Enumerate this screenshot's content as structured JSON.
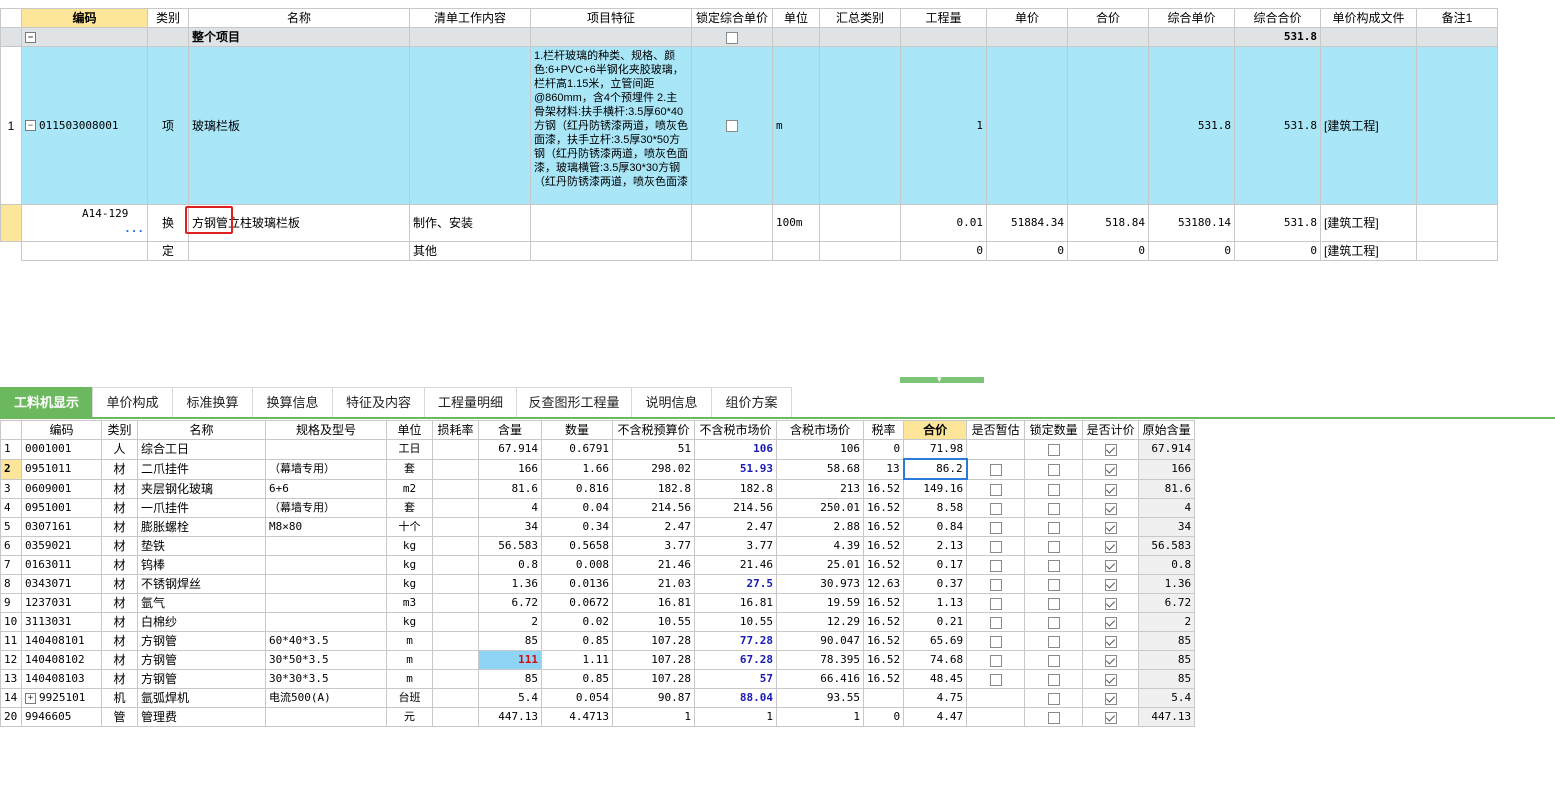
{
  "top_table": {
    "headers": [
      "编码",
      "类别",
      "名称",
      "清单工作内容",
      "项目特征",
      "锁定综合单价",
      "单位",
      "汇总类别",
      "工程量",
      "单价",
      "合价",
      "综合单价",
      "综合合价",
      "单价构成文件",
      "备注1"
    ],
    "group_row": {
      "name": "整个项目",
      "total": "531.8"
    },
    "main_row": {
      "num": "1",
      "code": "011503008001",
      "type": "项",
      "name": "玻璃栏板",
      "features": "1.栏杆玻璃的种类、规格、颜色:6+PVC+6半钢化夹胶玻璃，栏杆高1.15米，立管间距@860mm，含4个预埋件\n2.主骨架材料:扶手横杆:3.5厚60*40方钢（红丹防锈漆两道，喷灰色面漆，扶手立杆:3.5厚30*50方钢（红丹防锈漆两道，喷灰色面漆，玻璃横管:3.5厚30*30方钢（红丹防锈漆两道，喷灰色面漆",
      "unit": "m",
      "qty": "1",
      "comp_price": "531.8",
      "comp_total": "531.8",
      "file": "[建筑工程]"
    },
    "sub_rows": [
      {
        "code": "A14-129",
        "dots": "···",
        "type": "换",
        "name_a": "方钢管",
        "name_b": "立柱玻璃栏板",
        "content": "制作、安装",
        "unit": "100m",
        "qty": "0.01",
        "price": "51884.34",
        "total": "518.84",
        "comp_price": "53180.14",
        "comp_total": "531.8",
        "file": "[建筑工程]"
      },
      {
        "code": "",
        "dots": "",
        "type": "定",
        "name_a": "",
        "name_b": "",
        "content": "其他",
        "unit": "",
        "qty": "0",
        "price": "0",
        "total": "0",
        "comp_price": "0",
        "comp_total": "0",
        "file": "[建筑工程]"
      }
    ]
  },
  "tabs": [
    "工料机显示",
    "单价构成",
    "标准换算",
    "换算信息",
    "特征及内容",
    "工程量明细",
    "反查图形工程量",
    "说明信息",
    "组价方案"
  ],
  "bottom_table": {
    "headers": [
      "编码",
      "类别",
      "名称",
      "规格及型号",
      "单位",
      "损耗率",
      "含量",
      "数量",
      "不含税预算价",
      "不含税市场价",
      "含税市场价",
      "税率",
      "合价",
      "是否暂估",
      "锁定数量",
      "是否计价",
      "原始含量"
    ],
    "rows": [
      {
        "n": "1",
        "code": "0001001",
        "type": "人",
        "name": "综合工日",
        "spec": "",
        "unit": "工日",
        "qty": "67.914",
        "amt": "0.6791",
        "budget": "51",
        "market": "106",
        "market_tax": "106",
        "tax": "0",
        "total": "71.98",
        "est": "",
        "lock": "off",
        "priced": "on",
        "orig": "67.914"
      },
      {
        "n": "2",
        "code": "0951011",
        "type": "材",
        "name": "二爪挂件",
        "spec": "（幕墙专用）",
        "unit": "套",
        "qty": "166",
        "amt": "1.66",
        "budget": "298.02",
        "market": "51.93",
        "market_tax": "58.68",
        "tax": "13",
        "total": "86.2",
        "est": "off",
        "lock": "off",
        "priced": "on",
        "orig": "166"
      },
      {
        "n": "3",
        "code": "0609001",
        "type": "材",
        "name": "夹层钢化玻璃",
        "spec": "6+6",
        "unit": "m2",
        "qty": "81.6",
        "amt": "0.816",
        "budget": "182.8",
        "market": "182.8",
        "market_tax": "213",
        "tax": "16.52",
        "total": "149.16",
        "est": "off",
        "lock": "off",
        "priced": "on",
        "orig": "81.6"
      },
      {
        "n": "4",
        "code": "0951001",
        "type": "材",
        "name": "一爪挂件",
        "spec": "（幕墙专用）",
        "unit": "套",
        "qty": "4",
        "amt": "0.04",
        "budget": "214.56",
        "market": "214.56",
        "market_tax": "250.01",
        "tax": "16.52",
        "total": "8.58",
        "est": "off",
        "lock": "off",
        "priced": "on",
        "orig": "4"
      },
      {
        "n": "5",
        "code": "0307161",
        "type": "材",
        "name": "膨胀螺栓",
        "spec": "M8×80",
        "unit": "十个",
        "qty": "34",
        "amt": "0.34",
        "budget": "2.47",
        "market": "2.47",
        "market_tax": "2.88",
        "tax": "16.52",
        "total": "0.84",
        "est": "off",
        "lock": "off",
        "priced": "on",
        "orig": "34"
      },
      {
        "n": "6",
        "code": "0359021",
        "type": "材",
        "name": "垫铁",
        "spec": "",
        "unit": "kg",
        "qty": "56.583",
        "amt": "0.5658",
        "budget": "3.77",
        "market": "3.77",
        "market_tax": "4.39",
        "tax": "16.52",
        "total": "2.13",
        "est": "off",
        "lock": "off",
        "priced": "on",
        "orig": "56.583"
      },
      {
        "n": "7",
        "code": "0163011",
        "type": "材",
        "name": "钨棒",
        "spec": "",
        "unit": "kg",
        "qty": "0.8",
        "amt": "0.008",
        "budget": "21.46",
        "market": "21.46",
        "market_tax": "25.01",
        "tax": "16.52",
        "total": "0.17",
        "est": "off",
        "lock": "off",
        "priced": "on",
        "orig": "0.8"
      },
      {
        "n": "8",
        "code": "0343071",
        "type": "材",
        "name": "不锈钢焊丝",
        "spec": "",
        "unit": "kg",
        "qty": "1.36",
        "amt": "0.0136",
        "budget": "21.03",
        "market": "27.5",
        "market_tax": "30.973",
        "tax": "12.63",
        "total": "0.37",
        "est": "off",
        "lock": "off",
        "priced": "on",
        "orig": "1.36"
      },
      {
        "n": "9",
        "code": "1237031",
        "type": "材",
        "name": "氩气",
        "spec": "",
        "unit": "m3",
        "qty": "6.72",
        "amt": "0.0672",
        "budget": "16.81",
        "market": "16.81",
        "market_tax": "19.59",
        "tax": "16.52",
        "total": "1.13",
        "est": "off",
        "lock": "off",
        "priced": "on",
        "orig": "6.72"
      },
      {
        "n": "10",
        "code": "3113031",
        "type": "材",
        "name": "白棉纱",
        "spec": "",
        "unit": "kg",
        "qty": "2",
        "amt": "0.02",
        "budget": "10.55",
        "market": "10.55",
        "market_tax": "12.29",
        "tax": "16.52",
        "total": "0.21",
        "est": "off",
        "lock": "off",
        "priced": "on",
        "orig": "2"
      },
      {
        "n": "11",
        "code": "140408101",
        "type": "材",
        "name": "方钢管",
        "spec": "60*40*3.5",
        "unit": "m",
        "qty": "85",
        "amt": "0.85",
        "budget": "107.28",
        "market": "77.28",
        "market_tax": "90.047",
        "tax": "16.52",
        "total": "65.69",
        "est": "off",
        "lock": "off",
        "priced": "on",
        "orig": "85"
      },
      {
        "n": "12",
        "code": "140408102",
        "type": "材",
        "name": "方钢管",
        "spec": "30*50*3.5",
        "unit": "m",
        "qty": "111",
        "amt": "1.11",
        "budget": "107.28",
        "market": "67.28",
        "market_tax": "78.395",
        "tax": "16.52",
        "total": "74.68",
        "est": "off",
        "lock": "off",
        "priced": "on",
        "orig": "85"
      },
      {
        "n": "13",
        "code": "140408103",
        "type": "材",
        "name": "方钢管",
        "spec": "30*30*3.5",
        "unit": "m",
        "qty": "85",
        "amt": "0.85",
        "budget": "107.28",
        "market": "57",
        "market_tax": "66.416",
        "tax": "16.52",
        "total": "48.45",
        "est": "off",
        "lock": "off",
        "priced": "on",
        "orig": "85"
      },
      {
        "n": "14",
        "code": "9925101",
        "type": "机",
        "name": "氩弧焊机",
        "spec": "电流500(A)",
        "unit": "台班",
        "qty": "5.4",
        "amt": "0.054",
        "budget": "90.87",
        "market": "88.04",
        "market_tax": "93.55",
        "tax": "",
        "total": "4.75",
        "est": "",
        "lock": "off",
        "priced": "on",
        "orig": "5.4"
      },
      {
        "n": "20",
        "code": "9946605",
        "type": "管",
        "name": "管理费",
        "spec": "",
        "unit": "元",
        "qty": "447.13",
        "amt": "4.4713",
        "budget": "1",
        "market": "1",
        "market_tax": "1",
        "tax": "0",
        "total": "4.47",
        "est": "",
        "lock": "off",
        "priced": "on",
        "orig": "447.13"
      }
    ]
  },
  "colors": {
    "accent_green": "#6bb85f",
    "header_yellow": "#fde59a",
    "row_blue": "#a9e6f8",
    "value_blue": "#1a1ab5",
    "value_red": "#d01010"
  }
}
